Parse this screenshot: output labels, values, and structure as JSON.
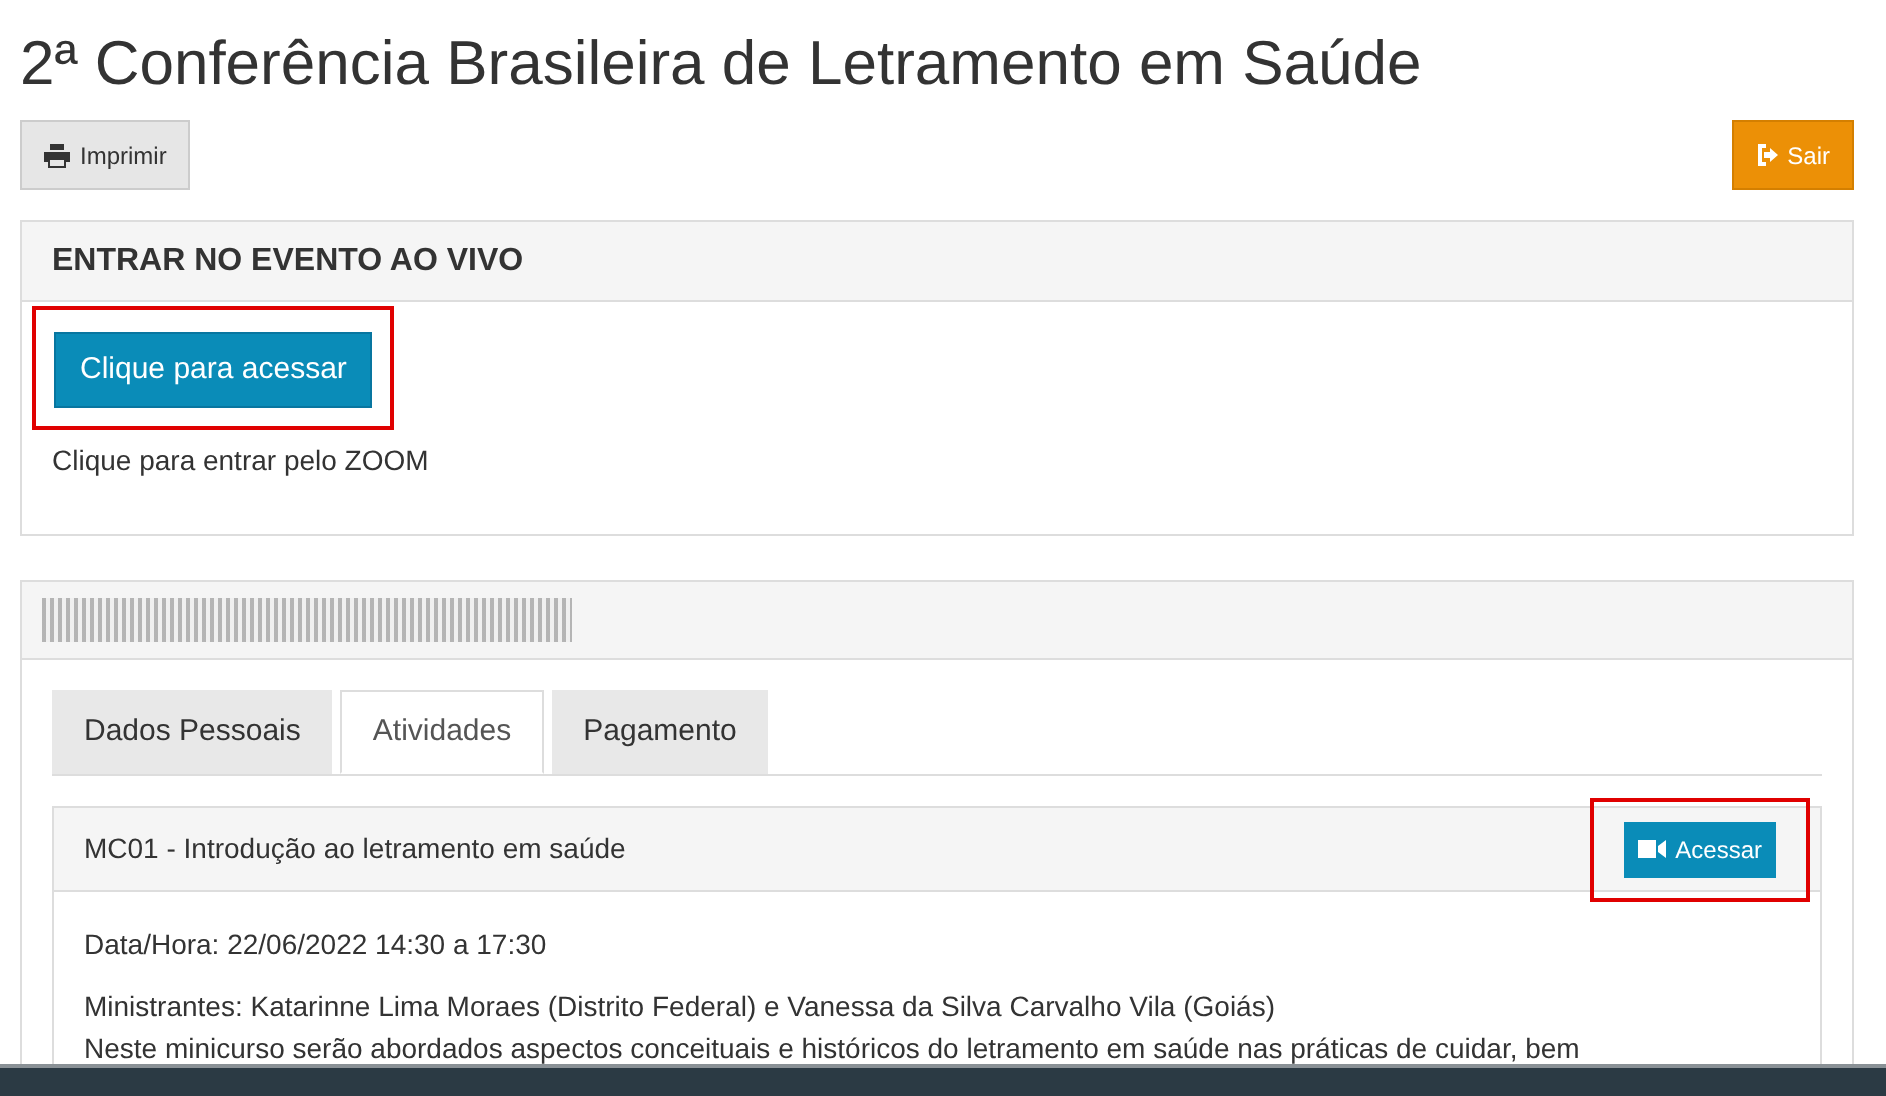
{
  "title": "2ª Conferência Brasileira de Letramento em Saúde",
  "print_button": {
    "label": "Imprimir"
  },
  "exit_button": {
    "label": "Sair"
  },
  "live_panel": {
    "heading": "ENTRAR NO EVENTO AO VIVO",
    "access_button": {
      "label": "Clique para acessar",
      "highlighted": true
    },
    "note": "Clique para entrar pelo ZOOM"
  },
  "registration_panel": {
    "tabs": [
      {
        "label": "Dados Pessoais",
        "selected": false
      },
      {
        "label": "Atividades",
        "selected": true
      },
      {
        "label": "Pagamento",
        "selected": false
      }
    ],
    "activity": {
      "title": "MC01 - Introdução ao letramento em saúde",
      "access_button": {
        "label": "Acessar",
        "highlighted": true
      },
      "datetime": "Data/Hora: 22/06/2022 14:30 a 17:30",
      "speakers": "Ministrantes: Katarinne Lima Moraes (Distrito Federal) e Vanessa da Silva Carvalho Vila (Goiás)",
      "description": "Neste minicurso serão abordados aspectos conceituais e históricos do letramento em saúde nas práticas de cuidar, bem"
    }
  }
}
